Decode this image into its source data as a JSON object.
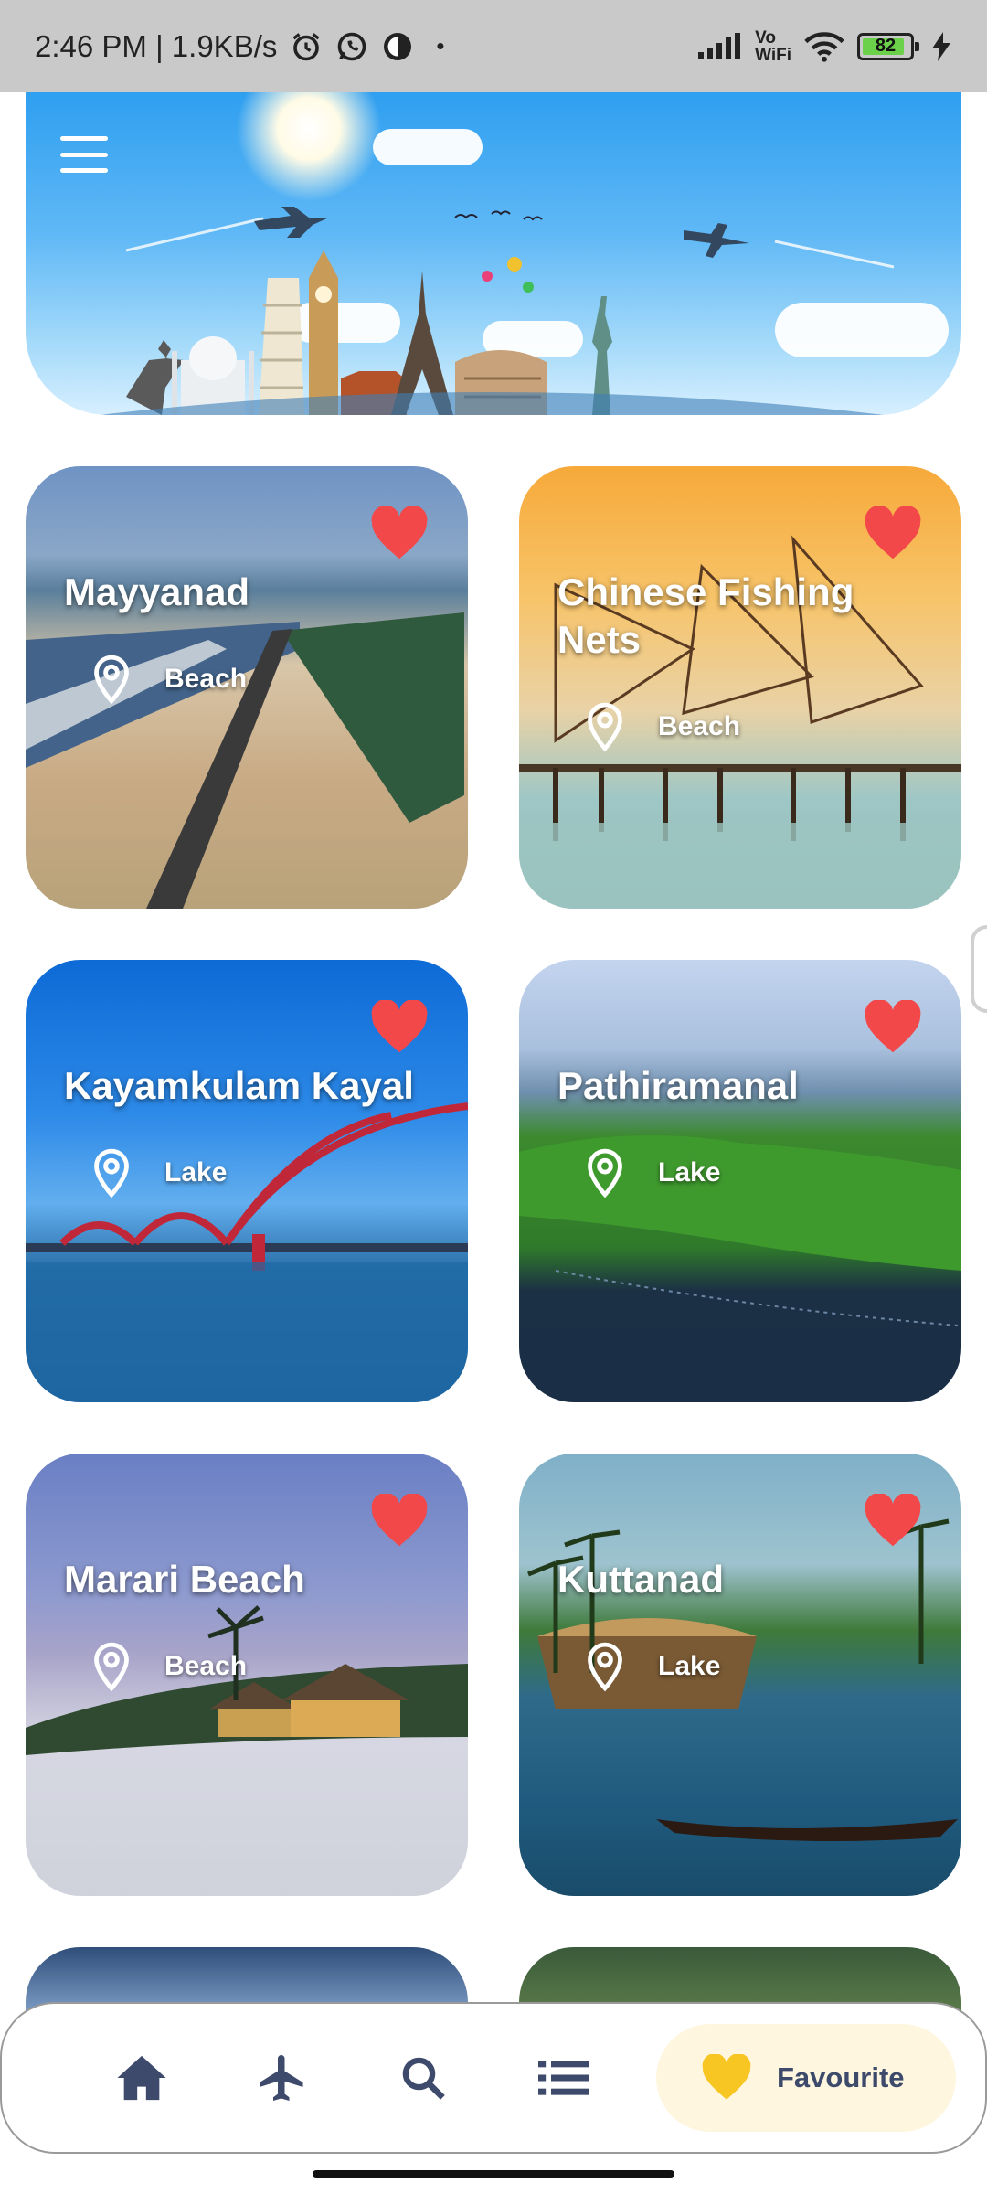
{
  "status_bar": {
    "time_speed": "2:46 PM | 1.9KB/s",
    "dot": "•",
    "network_label_top": "Vo",
    "network_label_bottom": "WiFi",
    "battery": "82",
    "icons": [
      "alarm-icon",
      "whatsapp-icon",
      "app-icon",
      "signal-icon",
      "wifi-icon",
      "battery-icon",
      "charging-icon"
    ]
  },
  "header": {
    "menu_icon": "hamburger-menu-icon",
    "banner": "travel-landmarks-banner"
  },
  "places": [
    {
      "name": "Mayyanad",
      "category": "Beach",
      "favorite": true
    },
    {
      "name": "Chinese Fishing Nets",
      "category": "Beach",
      "favorite": true
    },
    {
      "name": "Kayamkulam Kayal",
      "category": "Lake",
      "favorite": true
    },
    {
      "name": "Pathiramanal",
      "category": "Lake",
      "favorite": true
    },
    {
      "name": "Marari Beach",
      "category": "Beach",
      "favorite": true
    },
    {
      "name": "Kuttanad",
      "category": "Lake",
      "favorite": true
    }
  ],
  "bottom_nav": {
    "items": [
      "home-icon",
      "flight-icon",
      "search-icon",
      "list-icon"
    ],
    "active_label": "Favourite",
    "active_icon": "heart-icon"
  },
  "colors": {
    "heart": "#f2484a",
    "nav_icon": "#3d4a6b",
    "nav_active_bg": "#fff6df",
    "nav_active_icon": "#f7c623"
  }
}
